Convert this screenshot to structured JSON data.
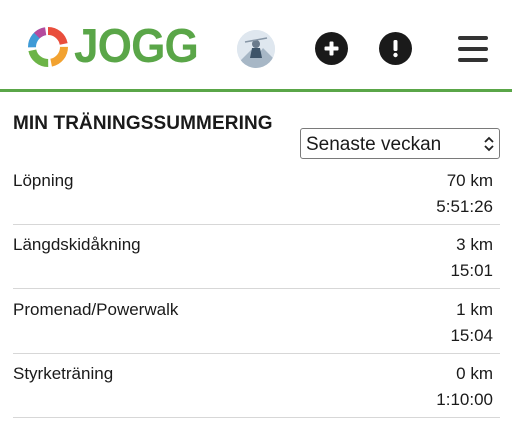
{
  "header": {
    "logo_text": "JOGG",
    "logo_icon": "jogg-ring-logo",
    "avatar": "user-avatar-photo",
    "add_icon": "plus-circle-icon",
    "alert_icon": "exclamation-circle-icon",
    "menu_icon": "hamburger-menu-icon",
    "brand_color": "#5aa648"
  },
  "summary": {
    "title": "MIN TRÄNINGSSUMMERING",
    "period_selected": "Senaste veckan",
    "rows": [
      {
        "activity": "Löpning",
        "distance": "70 km",
        "time": "5:51:26"
      },
      {
        "activity": "Längdskidåkning",
        "distance": "3 km",
        "time": "15:01"
      },
      {
        "activity": "Promenad/Powerwalk",
        "distance": "1 km",
        "time": "15:04"
      },
      {
        "activity": "Styrketräning",
        "distance": "0 km",
        "time": "1:10:00"
      }
    ]
  }
}
